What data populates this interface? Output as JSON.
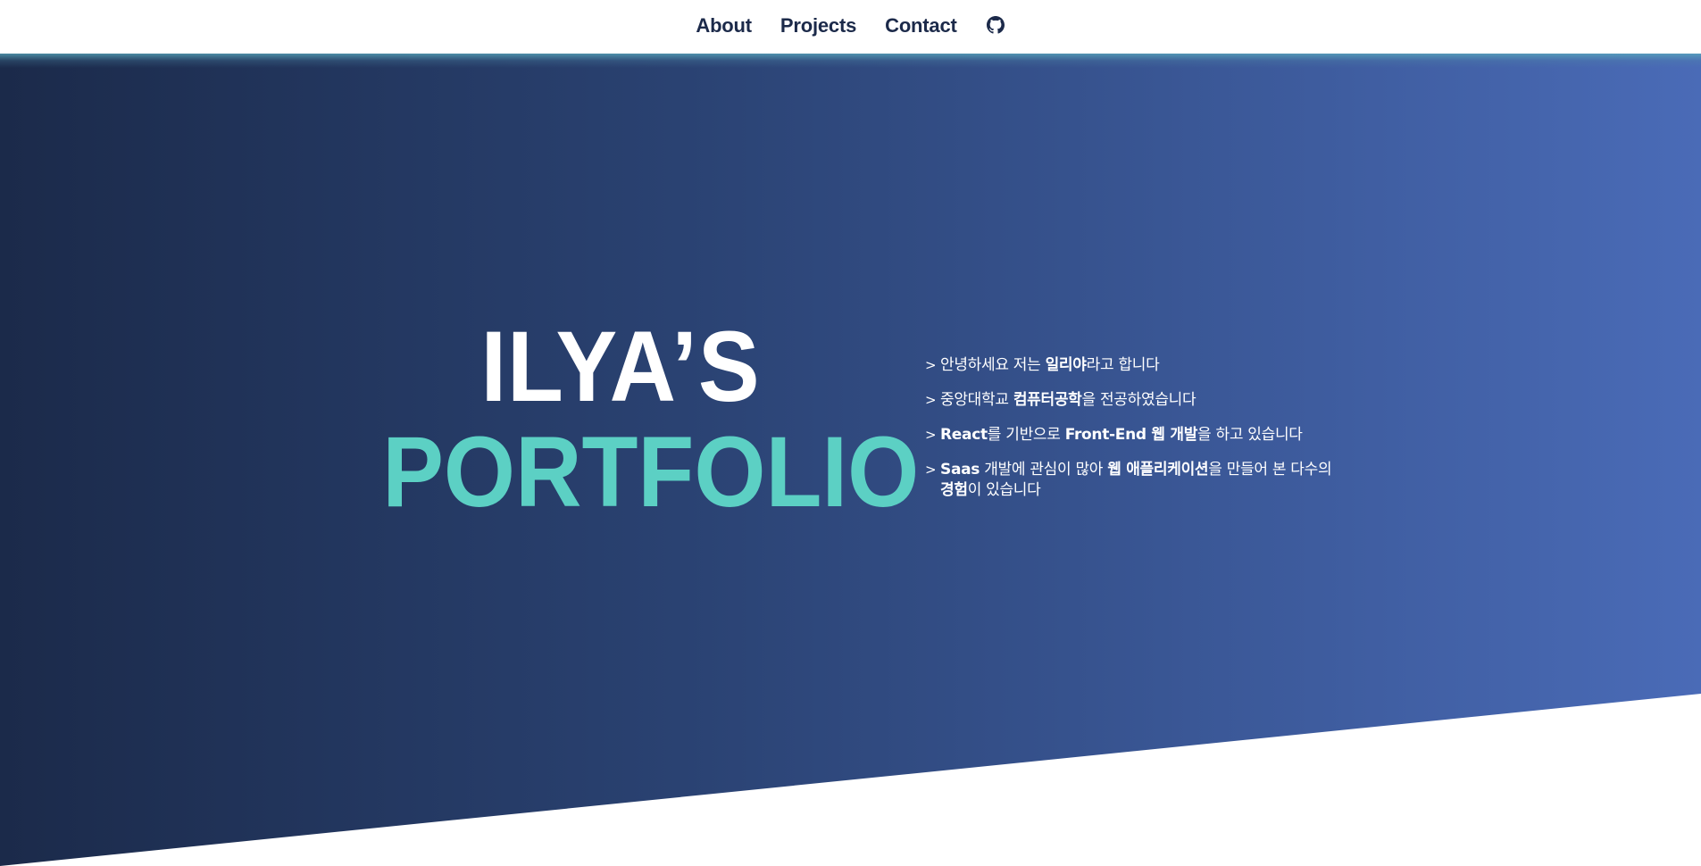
{
  "nav": {
    "about": "About",
    "projects": "Projects",
    "contact": "Contact",
    "github_icon": "github-icon"
  },
  "hero": {
    "title_line1": "ILYA’S",
    "title_line2": "PORTFOLIO",
    "chevron": ">",
    "intro": [
      {
        "parts": [
          {
            "text": "안녕하세요 저는 ",
            "bold": false
          },
          {
            "text": "일리야",
            "bold": true
          },
          {
            "text": "라고 합니다",
            "bold": false
          }
        ]
      },
      {
        "parts": [
          {
            "text": "중앙대학교 ",
            "bold": false
          },
          {
            "text": "컴퓨터공학",
            "bold": true
          },
          {
            "text": "을 전공하였습니다",
            "bold": false
          }
        ]
      },
      {
        "parts": [
          {
            "text": "React",
            "bold": true
          },
          {
            "text": "를 기반으로 ",
            "bold": false
          },
          {
            "text": "Front-End 웹 개발",
            "bold": true
          },
          {
            "text": "을 하고 있습니다",
            "bold": false
          }
        ]
      },
      {
        "parts": [
          {
            "text": "Saas",
            "bold": true
          },
          {
            "text": " 개발에 관심이 많아 ",
            "bold": false
          },
          {
            "text": "웹 애플리케이션",
            "bold": true
          },
          {
            "text": "을 만들어 본 다수의 ",
            "bold": false
          },
          {
            "text": "경험",
            "bold": true
          },
          {
            "text": "이 있습니다",
            "bold": false
          }
        ]
      }
    ]
  },
  "colors": {
    "nav_text": "#1c2a4a",
    "accent": "#5cd0c4",
    "gradient_start": "#1b2a4a",
    "gradient_end": "#4a6bb7"
  }
}
